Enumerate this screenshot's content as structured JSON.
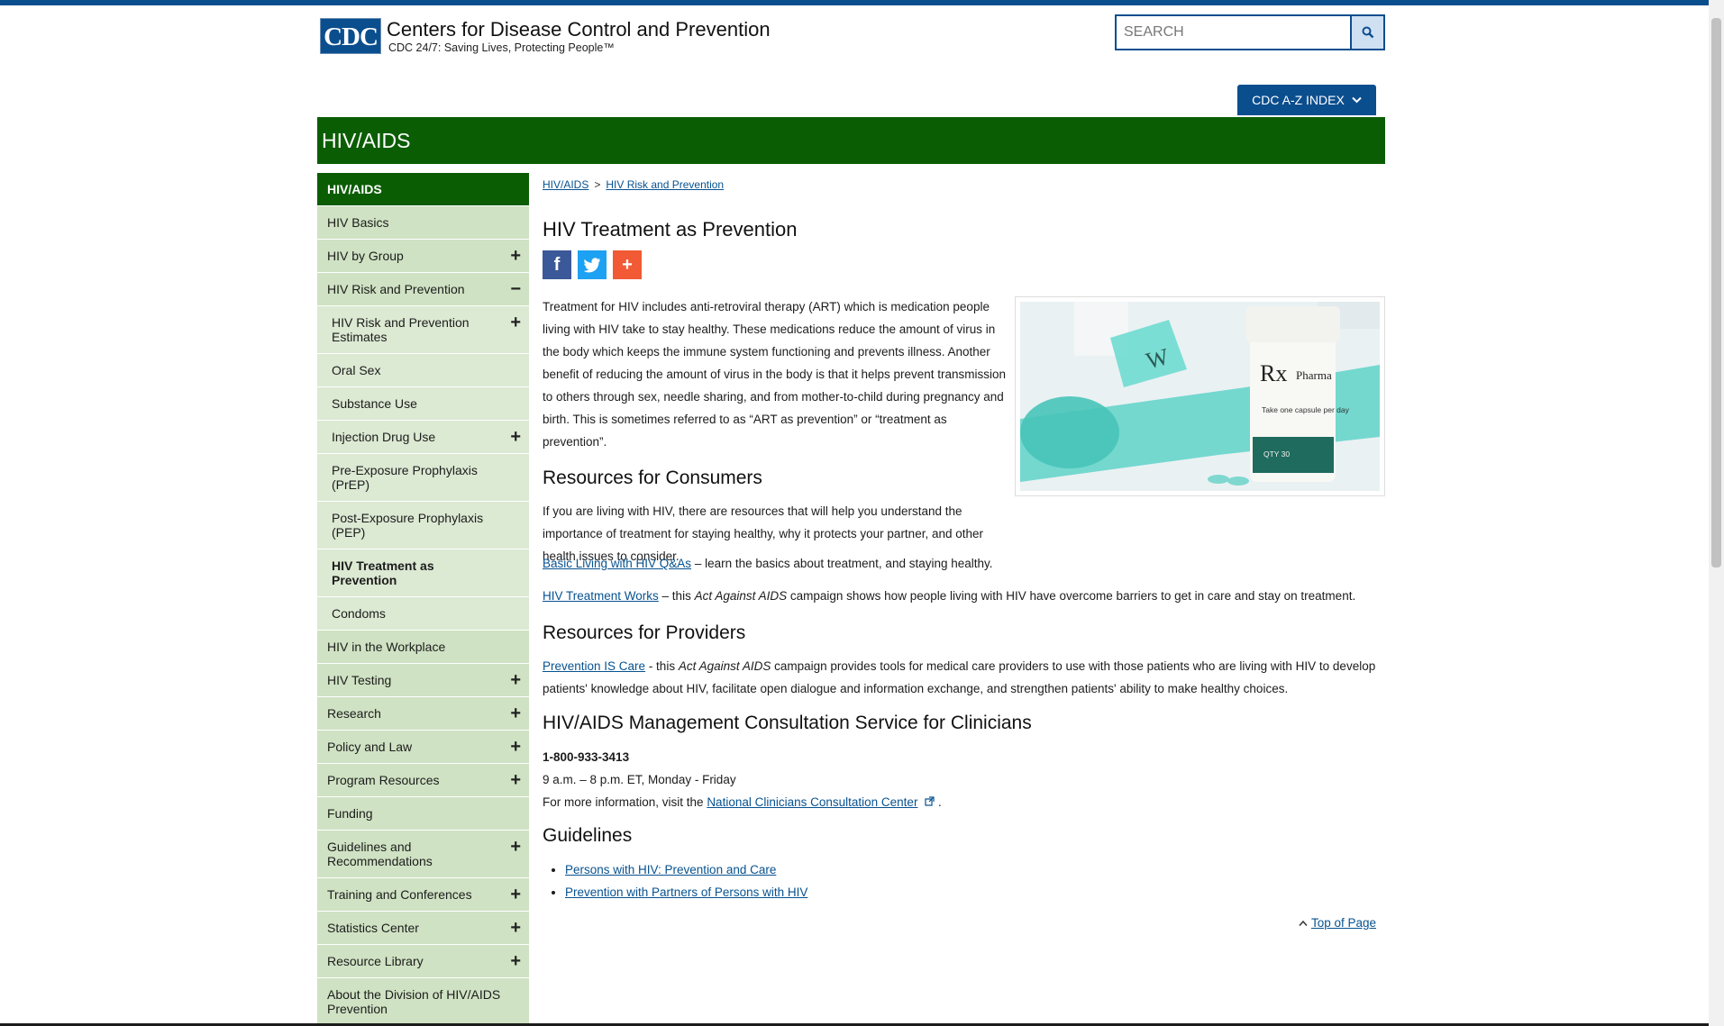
{
  "header": {
    "logo_text": "CDC",
    "site_name": "Centers for Disease Control and Prevention",
    "tagline": "CDC 24/7: Saving Lives, Protecting People™",
    "search_placeholder": "SEARCH",
    "az_index_label": "CDC A-Z INDEX"
  },
  "banner": {
    "title": "HIV/AIDS"
  },
  "sidebar": {
    "heading": "HIV/AIDS",
    "items": [
      {
        "label": "HIV Basics",
        "toggle": ""
      },
      {
        "label": "HIV by Group",
        "toggle": "+"
      },
      {
        "label": "HIV Risk and Prevention",
        "toggle": "−"
      },
      {
        "label": "HIV Risk and Prevention Estimates",
        "toggle": "+"
      },
      {
        "label": "Oral Sex",
        "toggle": ""
      },
      {
        "label": "Substance Use",
        "toggle": ""
      },
      {
        "label": "Injection Drug Use",
        "toggle": "+"
      },
      {
        "label": "Pre-Exposure Prophylaxis (PrEP)",
        "toggle": ""
      },
      {
        "label": "Post-Exposure Prophylaxis (PEP)",
        "toggle": ""
      },
      {
        "label": "HIV Treatment as Prevention",
        "toggle": ""
      },
      {
        "label": "Condoms",
        "toggle": ""
      },
      {
        "label": "HIV in the Workplace",
        "toggle": ""
      },
      {
        "label": "HIV Testing",
        "toggle": "+"
      },
      {
        "label": "Research",
        "toggle": "+"
      },
      {
        "label": "Policy and Law",
        "toggle": "+"
      },
      {
        "label": "Program Resources",
        "toggle": "+"
      },
      {
        "label": "Funding",
        "toggle": ""
      },
      {
        "label": "Guidelines and Recommendations",
        "toggle": "+"
      },
      {
        "label": "Training and Conferences",
        "toggle": "+"
      },
      {
        "label": "Statistics Center",
        "toggle": "+"
      },
      {
        "label": "Resource Library",
        "toggle": "+"
      },
      {
        "label": "About the Division of HIV/AIDS Prevention",
        "toggle": ""
      }
    ]
  },
  "breadcrumb": {
    "home": "HIV/AIDS",
    "sep": ">",
    "current": "HIV Risk and Prevention"
  },
  "page": {
    "title": "HIV Treatment as Prevention",
    "intro": "Treatment for HIV includes anti-retroviral therapy (ART) which is medication people living with HIV take to stay healthy. These medications reduce the amount of virus in the body which keeps the immune system functioning and prevents illness. Another benefit of reducing the amount of virus in the body is that it helps prevent transmission to others through sex, needle sharing, and from mother-to-child during pregnancy and birth. This is sometimes referred to as “ART as prevention” or “treatment as prevention”.",
    "image_label_rx": "Rx",
    "image_label_pharm": "Pharma",
    "image_label_dose": "Take one capsule per day",
    "image_label_qty": "QTY 30",
    "consumers_heading": "Resources for Consumers",
    "consumers_intro": "If you are living with HIV, there are resources that will help you understand the importance of treatment for staying healthy, why it protects your partner, and other health issues to consider.",
    "link1": "Basic Living with HIV Q&As",
    "link1_desc": " – learn the basics about treatment, and staying healthy.",
    "link2": "HIV Treatment Works",
    "link2_pre": " – this ",
    "link2_italic": "Act Against AIDS",
    "link2_desc": " campaign shows how people living with HIV have overcome barriers to get in care and stay on treatment.",
    "providers_heading": "Resources for Providers",
    "link3": "Prevention IS Care",
    "link3_pre": " - this ",
    "link3_italic": "Act Against AIDS",
    "link3_desc": " campaign provides tools for medical care providers to use with those patients who are living with HIV to develop patients' knowledge about HIV, facilitate open dialogue and information exchange, and strengthen patients' ability to make healthy choices.",
    "consult_heading": "HIV/AIDS Management Consultation Service for Clinicians",
    "phone": "1-800-933-3413",
    "hours": "9 a.m. – 8 p.m. ET, Monday - Friday",
    "more_info_pre": "For more information, visit the ",
    "more_info_link": "National Clinicians Consultation Center",
    "more_info_post": " .",
    "guidelines_heading": "Guidelines",
    "guidelines": [
      "Persons with HIV: Prevention and Care",
      "Prevention with Partners of Persons with HIV"
    ],
    "top_of_page": "Top of Page"
  }
}
